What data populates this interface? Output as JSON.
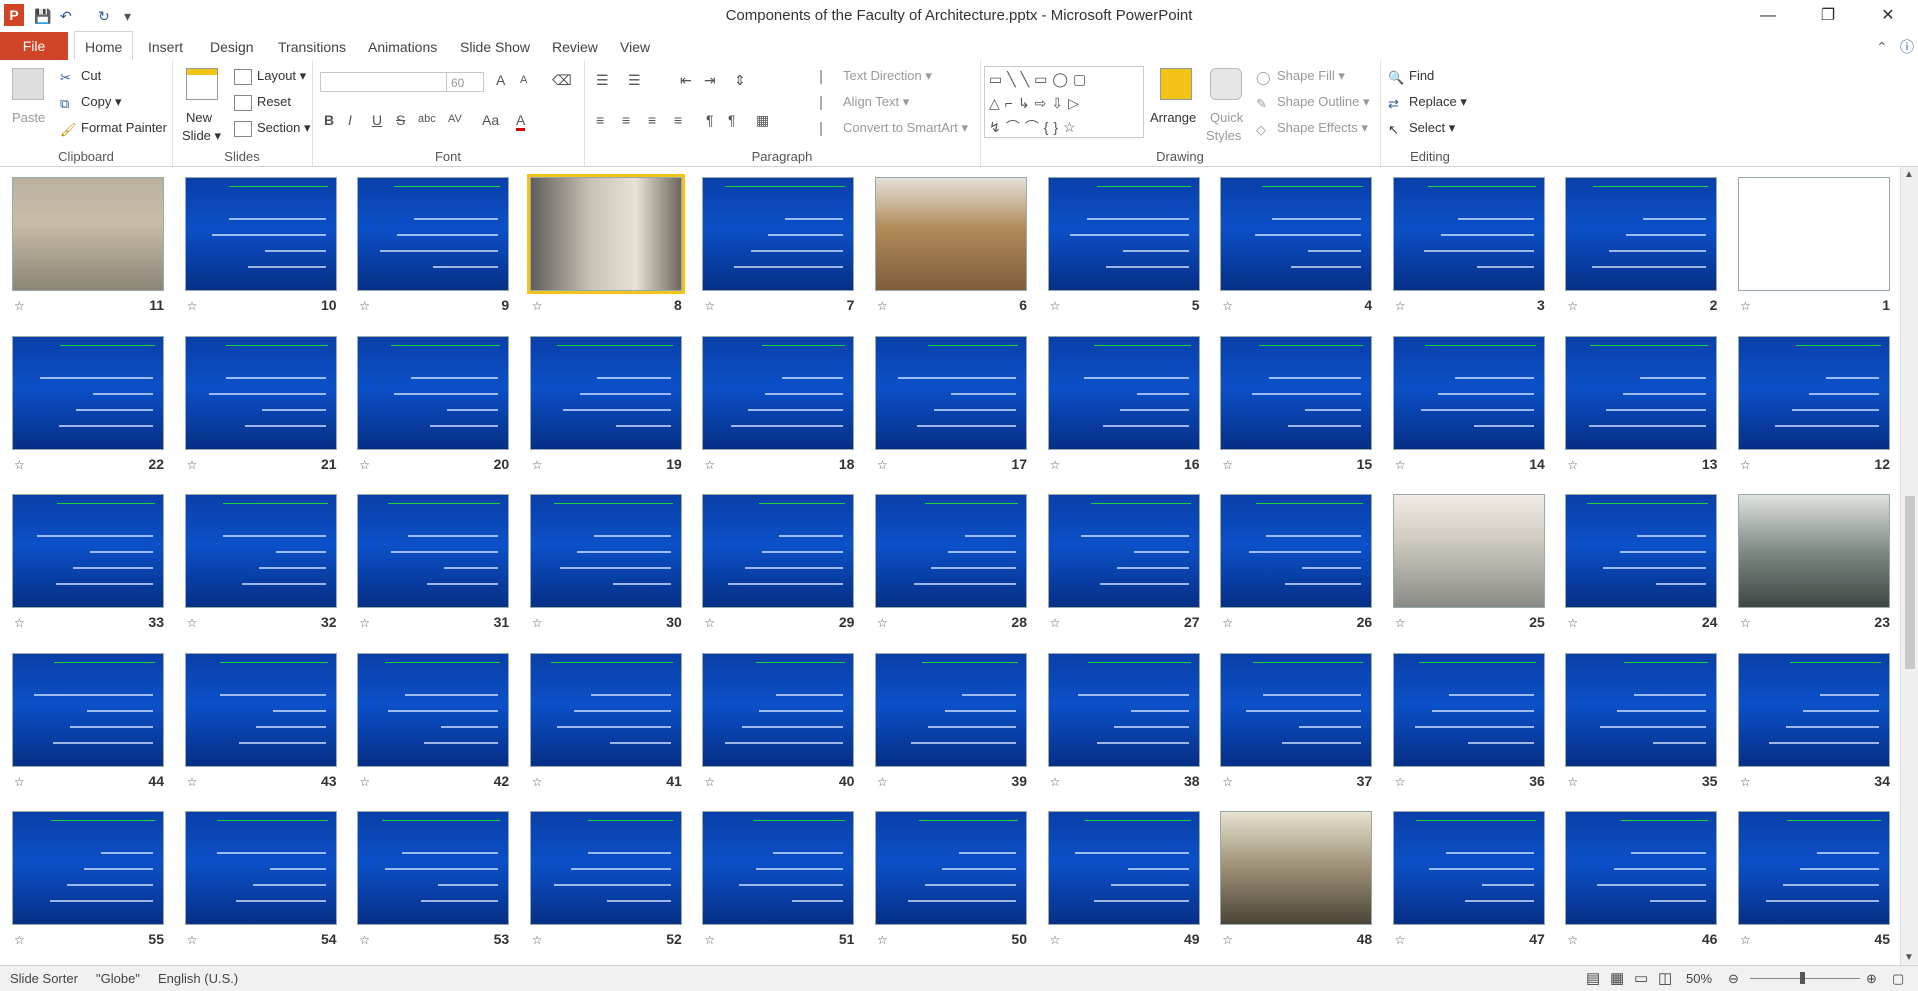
{
  "window": {
    "title": "Components of the Faculty of Architecture.pptx - Microsoft PowerPoint",
    "app_icon": "P",
    "minimize": "—",
    "restore": "❐",
    "close": "✕"
  },
  "tabs": [
    {
      "label": "File"
    },
    {
      "label": "Home"
    },
    {
      "label": "Insert"
    },
    {
      "label": "Design"
    },
    {
      "label": "Transitions"
    },
    {
      "label": "Animations"
    },
    {
      "label": "Slide Show"
    },
    {
      "label": "Review"
    },
    {
      "label": "View"
    }
  ],
  "ribbon": {
    "clipboard": {
      "label": "Clipboard",
      "paste": "Paste",
      "cut": "Cut",
      "copy": "Copy",
      "format_painter": "Format Painter"
    },
    "slides": {
      "label": "Slides",
      "new_slide": "New",
      "new_slide2": "Slide",
      "layout": "Layout",
      "reset": "Reset",
      "section": "Section"
    },
    "font": {
      "label": "Font",
      "size": "60",
      "bold": "B",
      "italic": "I",
      "underline": "U",
      "strike": "S",
      "shadow": "abc",
      "spacing": "AV",
      "case": "Aa",
      "color": "A",
      "grow": "A",
      "shrink": "A"
    },
    "paragraph": {
      "label": "Paragraph",
      "text_direction": "Text Direction",
      "align_text": "Align Text",
      "convert": "Convert to SmartArt"
    },
    "drawing": {
      "label": "Drawing",
      "arrange": "Arrange",
      "quick_styles": "Quick",
      "quick_styles2": "Styles",
      "shape_fill": "Shape Fill",
      "shape_outline": "Shape Outline",
      "shape_effects": "Shape Effects"
    },
    "editing": {
      "label": "Editing",
      "find": "Find",
      "replace": "Replace",
      "select": "Select"
    }
  },
  "selected_slide": 8,
  "slides": [
    {
      "n": "1",
      "kind": "calli"
    },
    {
      "n": "2",
      "kind": "text"
    },
    {
      "n": "3",
      "kind": "text"
    },
    {
      "n": "4",
      "kind": "text"
    },
    {
      "n": "5",
      "kind": "text"
    },
    {
      "n": "6",
      "kind": "pic3"
    },
    {
      "n": "7",
      "kind": "text"
    },
    {
      "n": "8",
      "kind": "pic2"
    },
    {
      "n": "9",
      "kind": "text"
    },
    {
      "n": "10",
      "kind": "text"
    },
    {
      "n": "11",
      "kind": "pic1"
    },
    {
      "n": "12",
      "kind": "text"
    },
    {
      "n": "13",
      "kind": "text"
    },
    {
      "n": "14",
      "kind": "text"
    },
    {
      "n": "15",
      "kind": "text"
    },
    {
      "n": "16",
      "kind": "text"
    },
    {
      "n": "17",
      "kind": "text"
    },
    {
      "n": "18",
      "kind": "text"
    },
    {
      "n": "19",
      "kind": "text"
    },
    {
      "n": "20",
      "kind": "text"
    },
    {
      "n": "21",
      "kind": "text"
    },
    {
      "n": "22",
      "kind": "text"
    },
    {
      "n": "23",
      "kind": "pic5"
    },
    {
      "n": "24",
      "kind": "text"
    },
    {
      "n": "25",
      "kind": "pic4"
    },
    {
      "n": "26",
      "kind": "text"
    },
    {
      "n": "27",
      "kind": "text"
    },
    {
      "n": "28",
      "kind": "text"
    },
    {
      "n": "29",
      "kind": "text"
    },
    {
      "n": "30",
      "kind": "text"
    },
    {
      "n": "31",
      "kind": "text"
    },
    {
      "n": "32",
      "kind": "text"
    },
    {
      "n": "33",
      "kind": "text"
    },
    {
      "n": "34",
      "kind": "text"
    },
    {
      "n": "35",
      "kind": "text"
    },
    {
      "n": "36",
      "kind": "text"
    },
    {
      "n": "37",
      "kind": "text"
    },
    {
      "n": "38",
      "kind": "text"
    },
    {
      "n": "39",
      "kind": "text"
    },
    {
      "n": "40",
      "kind": "text"
    },
    {
      "n": "41",
      "kind": "text"
    },
    {
      "n": "42",
      "kind": "text"
    },
    {
      "n": "43",
      "kind": "text"
    },
    {
      "n": "44",
      "kind": "text"
    },
    {
      "n": "45",
      "kind": "text"
    },
    {
      "n": "46",
      "kind": "text"
    },
    {
      "n": "47",
      "kind": "text"
    },
    {
      "n": "48",
      "kind": "pic6"
    },
    {
      "n": "49",
      "kind": "text"
    },
    {
      "n": "50",
      "kind": "text"
    },
    {
      "n": "51",
      "kind": "text"
    },
    {
      "n": "52",
      "kind": "text"
    },
    {
      "n": "53",
      "kind": "text"
    },
    {
      "n": "54",
      "kind": "text"
    },
    {
      "n": "55",
      "kind": "text"
    }
  ],
  "statusbar": {
    "view": "Slide Sorter",
    "theme": "\"Globe\"",
    "language": "English (U.S.)",
    "zoom": "50%"
  },
  "colors": {
    "accent": "#d04525",
    "slide_blue": "#0b50c8",
    "slide_title_green": "#19d23b",
    "selection": "#f2c318"
  }
}
